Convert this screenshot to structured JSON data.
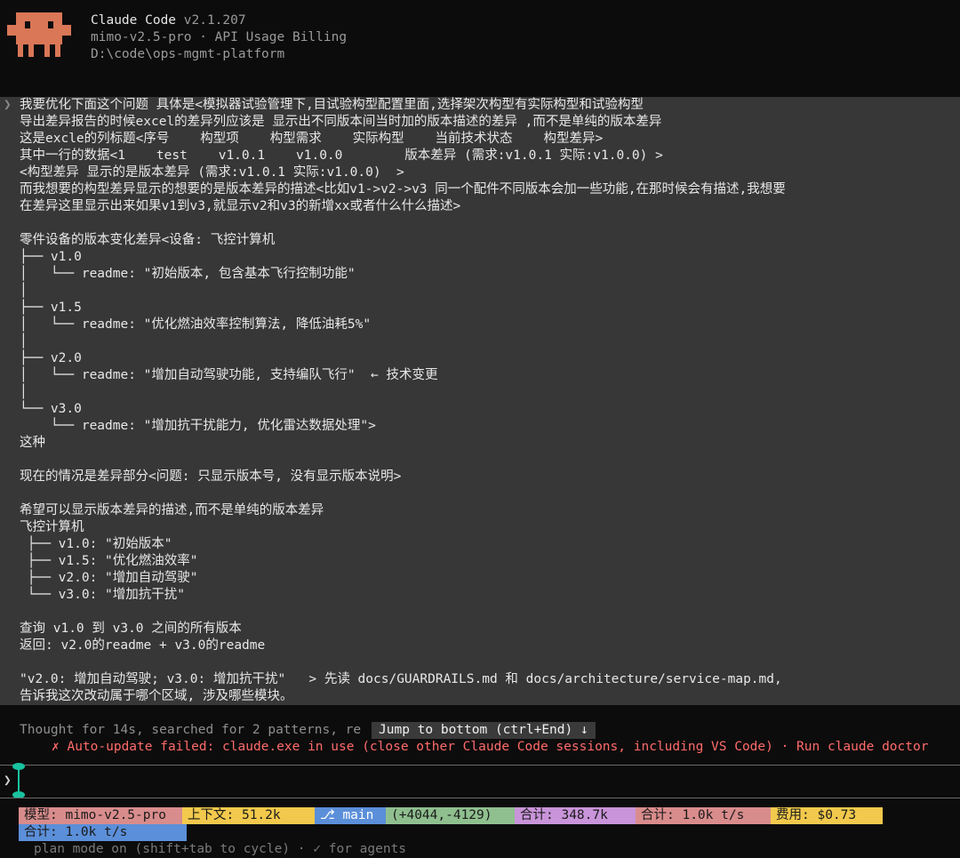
{
  "header": {
    "app_name": "Claude Code",
    "version": "v2.1.207",
    "model_line": "mimo-v2.5-pro · API Usage Billing",
    "path": "D:\\code\\ops-mgmt-platform"
  },
  "prompt": {
    "caret": "❯",
    "lines": [
      "我要优化下面这个问题 具体是<模拟器试验管理下,目试验构型配置里面,选择架次构型有实际构型和试验构型",
      "导出差异报告的时候excel的差异列应该是 显示出不同版本间当时加的版本描述的差异 ,而不是单纯的版本差异",
      "这是excle的列标题<序号    构型项    构型需求    实际构型    当前技术状态    构型差异>",
      "其中一行的数据<1    test    v1.0.1    v1.0.0        版本差异 (需求:v1.0.1 实际:v1.0.0) >",
      "<构型差异 显示的是版本差异 (需求:v1.0.1 实际:v1.0.0)  >",
      "而我想要的构型差异显示的想要的是版本差异的描述<比如v1->v2->v3 同一个配件不同版本会加一些功能,在那时候会有描述,我想要",
      "在差异这里显示出来如果v1到v3,就显示v2和v3的新增xx或者什么什么描述>",
      "",
      "零件设备的版本变化差异<设备: 飞控计算机",
      "├── v1.0",
      "│   └── readme: \"初始版本, 包含基本飞行控制功能\"",
      "│",
      "├── v1.5",
      "│   └── readme: \"优化燃油效率控制算法, 降低油耗5%\"",
      "│",
      "├── v2.0",
      "│   └── readme: \"增加自动驾驶功能, 支持编队飞行\"  ← 技术变更",
      "│",
      "└── v3.0",
      "    └── readme: \"增加抗干扰能力, 优化雷达数据处理\">",
      "这种",
      "",
      "现在的情况是差异部分<问题: 只显示版本号, 没有显示版本说明>",
      "",
      "希望可以显示版本差异的描述,而不是单纯的版本差异",
      "飞控计算机",
      " ├── v1.0: \"初始版本\"",
      " ├── v1.5: \"优化燃油效率\"",
      " ├── v2.0: \"增加自动驾驶\"",
      " └── v3.0: \"增加抗干扰\"",
      "",
      "查询 v1.0 到 v3.0 之间的所有版本",
      "返回: v2.0的readme + v3.0的readme",
      "",
      "\"v2.0: 增加自动驾驶; v3.0: 增加抗干扰\"   > 先读 docs/GUARDRAILS.md 和 docs/architecture/service-map.md,",
      "告诉我这次改动属于哪个区域, 涉及哪些模块。"
    ]
  },
  "status": {
    "thought": "Thought for 14s, searched for 2 patterns, re",
    "jump_button": "Jump to bottom (ctrl+End) ↓",
    "update_error": "✗ Auto-update failed: claude.exe in use (close other Claude Code sessions, including VS Code) · Run claude doctor"
  },
  "input": {
    "caret": "❯"
  },
  "statusbar": {
    "model": "模型: mimo-v2.5-pro",
    "context": "上下文: 51.2k",
    "branch": "⎇ main",
    "diff": "(+4044,-4129)",
    "total_tokens": "合计: 348.7k",
    "speed": "合计: 1.0k t/s",
    "cost": "费用: $0.73",
    "speed2": "合计: 1.0k t/s",
    "mode_line": "plan mode on (shift+tab to cycle) · ✓ for agents"
  },
  "colors": {
    "accent": "#d97757",
    "model_bg": "#d98c8c",
    "context_bg": "#f2c94c",
    "branch_bg": "#5b8fd9",
    "diff_bg": "#8fbf8f",
    "total_bg": "#c994d9",
    "speed_bg": "#d98c8c",
    "cost_bg": "#f2c94c",
    "error": "#ff6b6b"
  }
}
